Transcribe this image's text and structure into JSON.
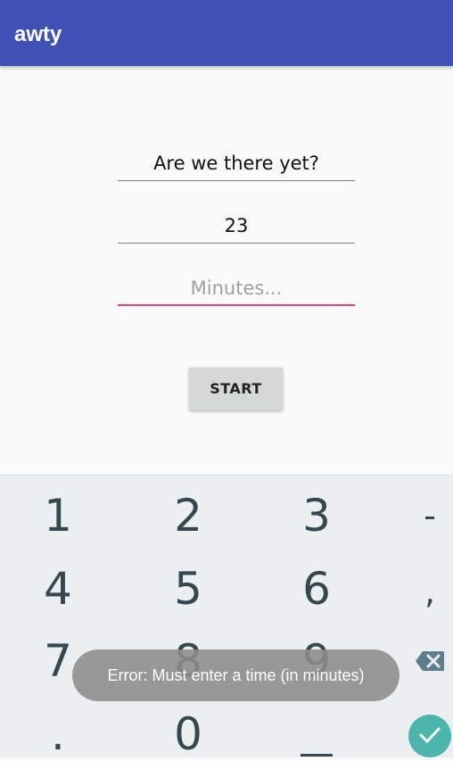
{
  "app_bar": {
    "title": "awty",
    "color": "#3f51b5"
  },
  "form": {
    "message_value": "Are we there yet?",
    "phone_value": "23",
    "minutes_placeholder": "Minutes...",
    "start_label": "START",
    "accent_color": "#ec407a"
  },
  "keyboard": {
    "keys": [
      "1",
      "2",
      "3",
      "-",
      "4",
      "5",
      "6",
      ",",
      "7",
      "8",
      "9",
      ".",
      "0"
    ],
    "icons": [
      "backspace-icon",
      "checkmark-icon"
    ],
    "done_color": "#4db6ac"
  },
  "toast": {
    "text": "Error: Must enter a time (in minutes)"
  }
}
